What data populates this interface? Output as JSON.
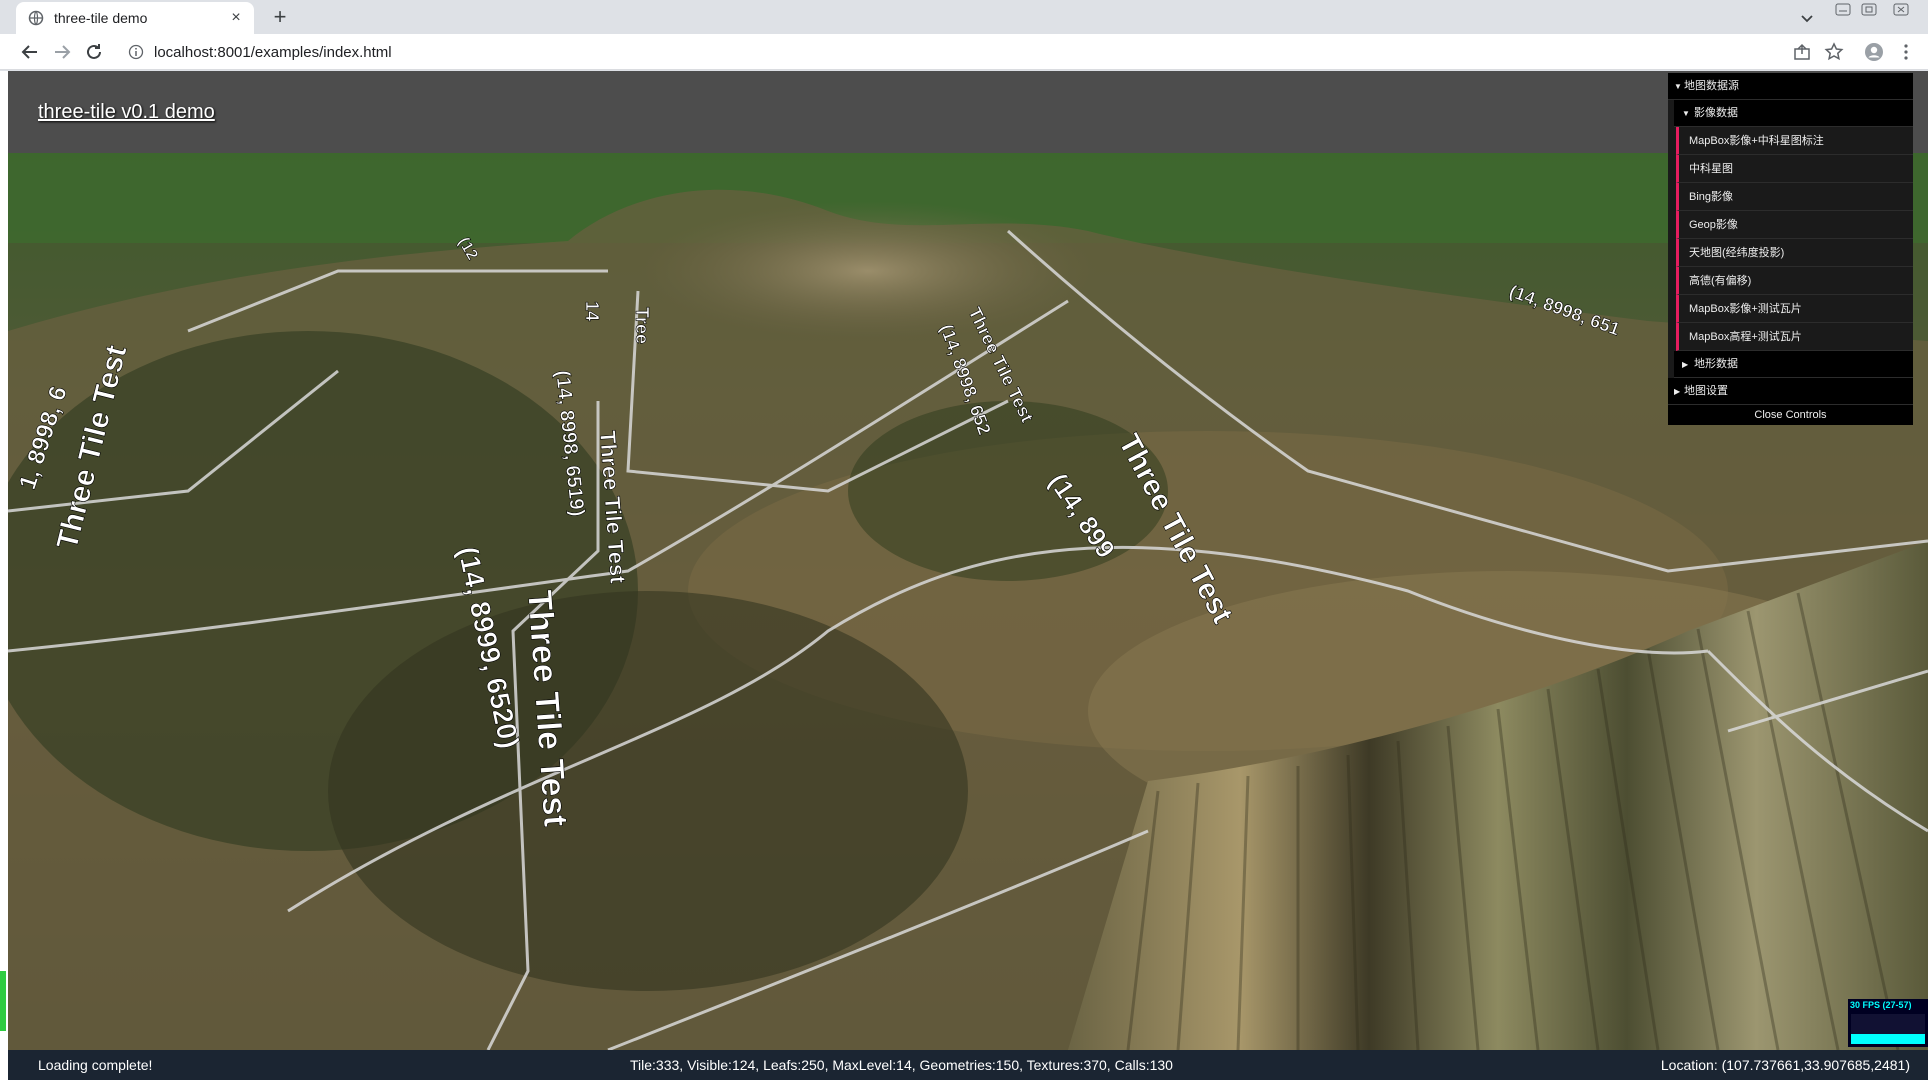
{
  "browser": {
    "tab_title": "three-tile demo",
    "url": "localhost:8001/examples/index.html"
  },
  "demo": {
    "title": "three-tile v0.1 demo"
  },
  "gui": {
    "root_folder": "地图数据源",
    "imagery_folder": "影像数据",
    "imagery_items": [
      "MapBox影像+中科星图标注",
      "中科星图",
      "Bing影像",
      "Geop影像",
      "天地图(经纬度投影)",
      "高德(有偏移)",
      "MapBox影像+测试瓦片",
      "MapBox高程+测试瓦片"
    ],
    "terrain_folder": "地形数据",
    "settings_folder": "地图设置",
    "close_label": "Close Controls"
  },
  "fps": {
    "label": "30 FPS (27-57)"
  },
  "status": {
    "left": "Loading complete!",
    "middle": "Tile:333, Visible:124, Leafs:250, MaxLevel:14, Geometries:150, Textures:370, Calls:130",
    "right": "Location: (107.737661,33.907685,2481)"
  },
  "scene_labels": {
    "tile_text": "Three Tile Test",
    "coord_a": "(14, 8999, 6520)",
    "coord_b": "(14, 8998, 6519)",
    "coord_c": "(14, 8998, 652",
    "coord_d": "(14, 899",
    "coord_e": "(14, 8998, 651",
    "num_a": "1, 8998, 6",
    "num_b": "(14, 8999",
    "num_c": "(12",
    "num_d": "14",
    "tree": "Tree"
  }
}
